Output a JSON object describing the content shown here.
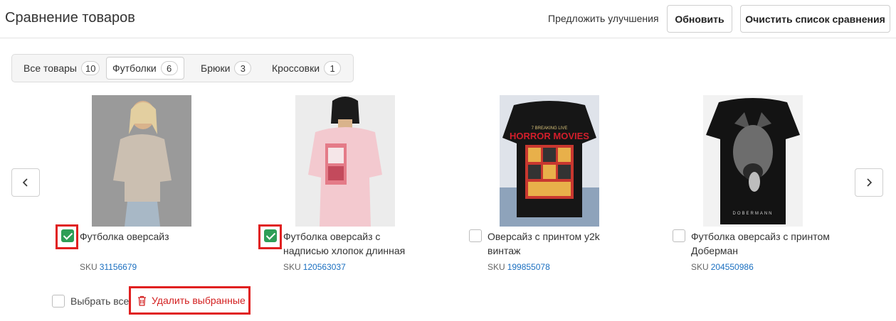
{
  "header": {
    "title": "Сравнение товаров",
    "suggest_label": "Предложить улучшения",
    "refresh_label": "Обновить",
    "clear_label": "Очистить список сравнения"
  },
  "tabs": [
    {
      "label": "Все товары",
      "count": "10",
      "active": false
    },
    {
      "label": "Футболки",
      "count": "6",
      "active": true
    },
    {
      "label": "Брюки",
      "count": "3",
      "active": false
    },
    {
      "label": "Кроссовки",
      "count": "1",
      "active": false
    }
  ],
  "products": [
    {
      "name": "Футболка оверсайз",
      "sku_label": "SKU",
      "sku": "31156679",
      "checked": true,
      "highlighted": true
    },
    {
      "name": "Футболка оверсайз с надписью хлопок длинная",
      "sku_label": "SKU",
      "sku": "120563037",
      "checked": true,
      "highlighted": true
    },
    {
      "name": "Оверсайз с принтом y2k винтаж",
      "sku_label": "SKU",
      "sku": "199855078",
      "checked": false,
      "highlighted": false
    },
    {
      "name": "Футболка оверсайз с принтом Доберман",
      "sku_label": "SKU",
      "sku": "204550986",
      "checked": false,
      "highlighted": false
    }
  ],
  "image_text": {
    "p3_tagline": "7 BREAKING LIVE",
    "p3_title": "HORROR MOVIES",
    "p4_brand": "DOBERMANN"
  },
  "footer": {
    "select_all_label": "Выбрать все",
    "delete_selected_label": "Удалить выбранные"
  },
  "colors": {
    "accent_green": "#2e9e57",
    "highlight_red": "#e02020",
    "link_blue": "#1a6fc0"
  },
  "icons": {
    "prev": "chevron-left-icon",
    "next": "chevron-right-icon",
    "delete": "trash-icon"
  }
}
